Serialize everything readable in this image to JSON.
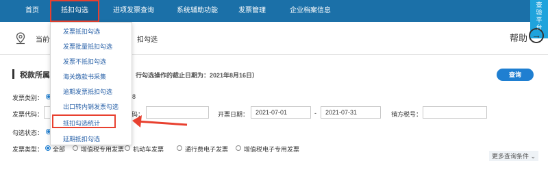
{
  "nav": {
    "items": [
      "首页",
      "抵扣勾选",
      "进项发票查询",
      "系统辅助功能",
      "发票管理",
      "企业档案信息"
    ],
    "side_tab": [
      "查",
      "验",
      "平",
      "台"
    ]
  },
  "breadcrumb": {
    "label": "当前位",
    "tail": "扣勾选"
  },
  "help": "帮助",
  "section": {
    "title": "税款所属期",
    "deadline": "行勾选操作的截止日期为：2021年8月16日）"
  },
  "query_button": "查询",
  "filters": {
    "invoice_category_label": "发票类别：",
    "invoice_category_tail": "8",
    "invoice_code_label": "发票代码：",
    "invoice_no_label": "码：",
    "date_label": "开票日期：",
    "date_from": "2021-07-01",
    "date_sep": "-",
    "date_to": "2021-07-31",
    "seller_tax_label": "销方税号：",
    "status_label": "勾选状态：",
    "type_label": "发票类型：",
    "type_options": [
      "全部",
      "增值税专用发票",
      "机动车发票",
      "通行费电子发票",
      "增值税电子专用发票"
    ]
  },
  "more_conditions": "更多查询条件",
  "dropdown": [
    "发票抵扣勾选",
    "发票批量抵扣勾选",
    "发票不抵扣勾选",
    "海关缴款书采集",
    "逾期发票抵扣勾选",
    "出口转内销发票勾选",
    "抵扣勾选统计",
    "延期抵扣勾选"
  ],
  "colors": {
    "nav": "#1b70a8",
    "highlight": "#e8402f",
    "link": "#2a62a8",
    "button": "#1f7fd1"
  }
}
